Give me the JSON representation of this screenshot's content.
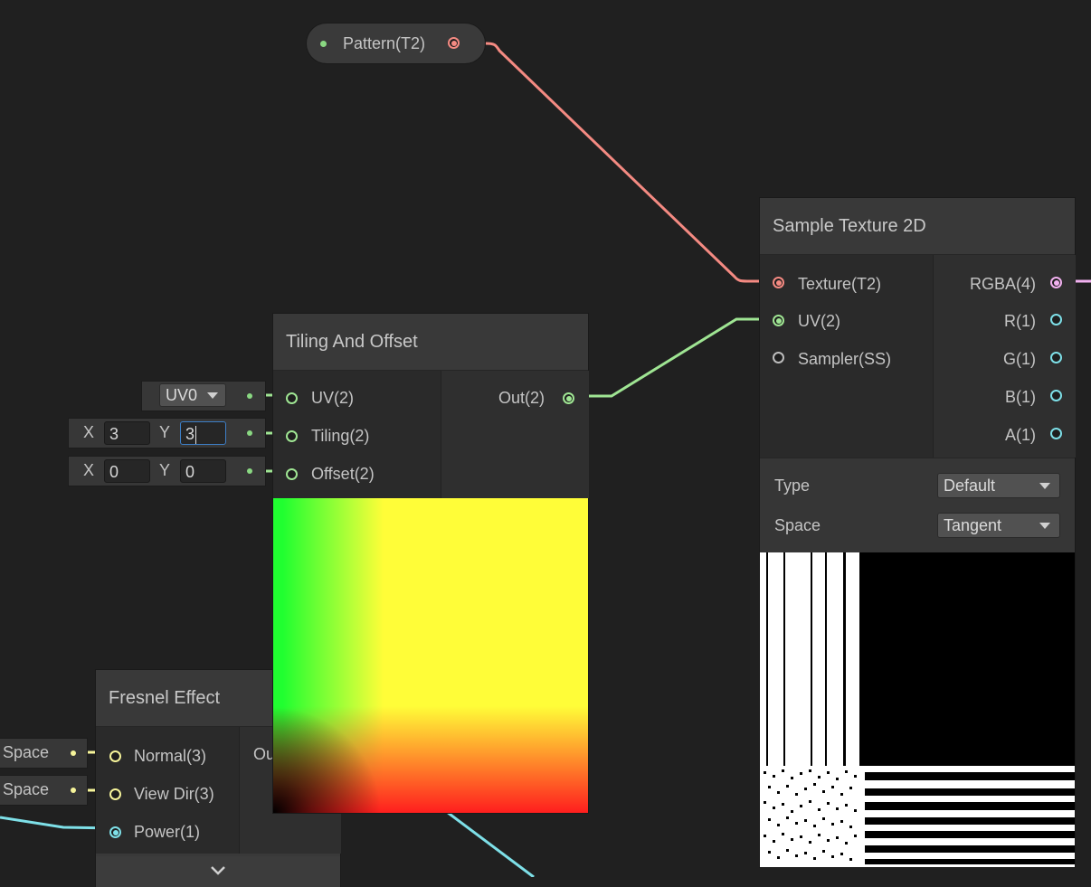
{
  "colors": {
    "background": "#202020",
    "node": "#393939",
    "texture_wire": "#f48a82",
    "vector2_wire": "#9fe593",
    "vector3_wire": "#f6f49a",
    "float_wire": "#7ee0e8",
    "vector4_wire": "#f2b1f0"
  },
  "property": {
    "label": "Pattern(T2)"
  },
  "tiling_node": {
    "title": "Tiling And Offset",
    "inputs": [
      "UV(2)",
      "Tiling(2)",
      "Offset(2)"
    ],
    "output": "Out(2)",
    "uv_dropdown": "UV0",
    "tiling": {
      "x_label": "X",
      "x": "3",
      "y_label": "Y",
      "y": "3"
    },
    "offset": {
      "x_label": "X",
      "x": "0",
      "y_label": "Y",
      "y": "0"
    }
  },
  "sample_node": {
    "title": "Sample Texture 2D",
    "inputs": [
      "Texture(T2)",
      "UV(2)",
      "Sampler(SS)"
    ],
    "outputs": [
      "RGBA(4)",
      "R(1)",
      "G(1)",
      "B(1)",
      "A(1)"
    ],
    "type_label": "Type",
    "type_value": "Default",
    "space_label": "Space",
    "space_value": "Tangent"
  },
  "fresnel_node": {
    "title": "Fresnel Effect",
    "inputs": [
      "Normal(3)",
      "View Dir(3)",
      "Power(1)"
    ],
    "output_partial": "Ou",
    "normal_field": "Space",
    "viewdir_field": "Space"
  }
}
